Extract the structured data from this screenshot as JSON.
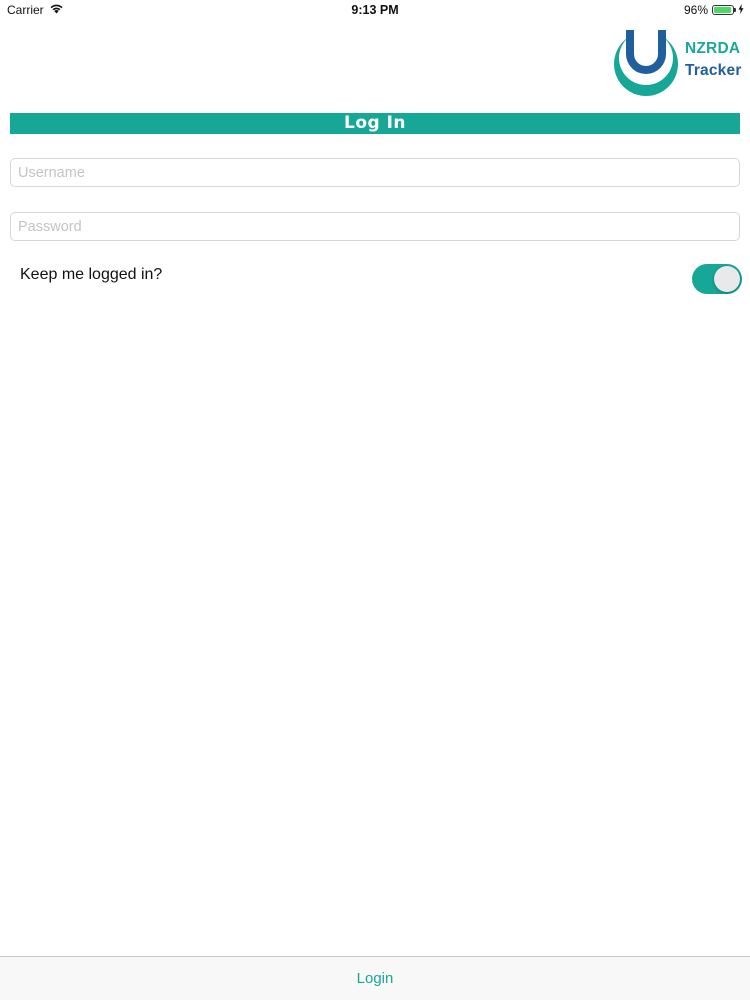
{
  "status_bar": {
    "carrier": "Carrier",
    "time": "9:13 PM",
    "battery_percent": "96%",
    "battery_level": 0.96,
    "icons": [
      "wifi-icon",
      "battery-icon",
      "charging-bolt-icon"
    ]
  },
  "logo": {
    "line1": "NZRDA",
    "line2": "Tracker",
    "colors": {
      "teal": "#17a797",
      "blue": "#1f5f9c"
    }
  },
  "header": {
    "title": "Log In"
  },
  "form": {
    "username": {
      "value": "",
      "placeholder": "Username"
    },
    "password": {
      "value": "",
      "placeholder": "Password"
    },
    "keep_logged_in": {
      "label": "Keep me logged in?",
      "on": true
    }
  },
  "toolbar": {
    "login_label": "Login"
  },
  "colors": {
    "accent": "#17a797",
    "toggle_on": "#17a797"
  }
}
